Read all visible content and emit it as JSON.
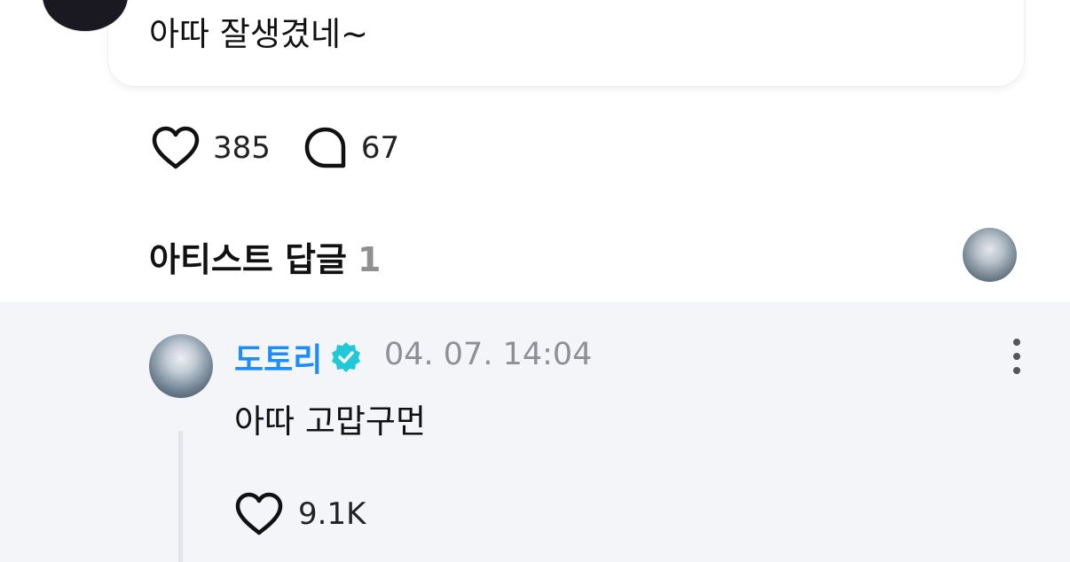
{
  "post": {
    "text": "아따 잘생겼네~",
    "like_count": "385",
    "comment_count": "67"
  },
  "artist_replies": {
    "title": "아티스트 답글",
    "count": "1"
  },
  "reply": {
    "author": "도토리",
    "timestamp": "04. 07. 14:04",
    "text": "아따 고맙구먼",
    "like_count": "9.1K"
  },
  "icons": {
    "like": "heart-icon",
    "comment": "speech-bubble-icon",
    "verified": "verified-badge-icon",
    "more": "more-vertical-icon"
  },
  "colors": {
    "author_name": "#1c8dfb",
    "verified_badge": "#20c8d8",
    "reply_background": "#f4f5f8",
    "muted_text": "#8f8f95"
  }
}
